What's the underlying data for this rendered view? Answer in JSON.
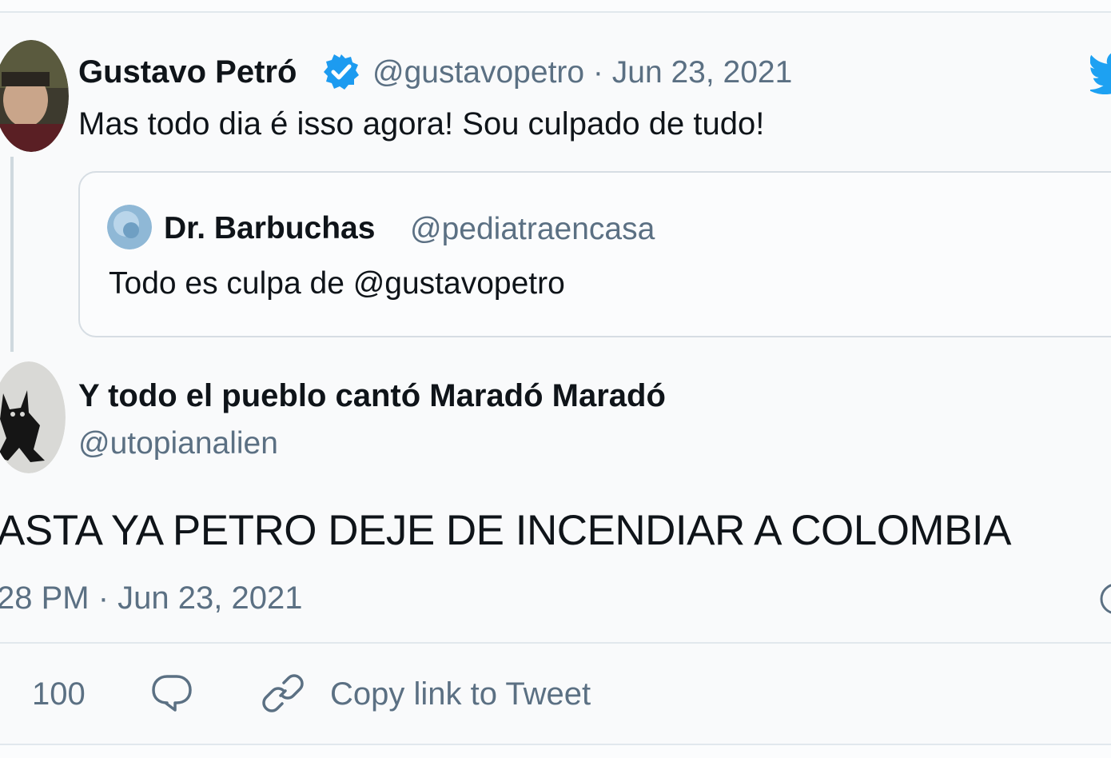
{
  "parent_tweet": {
    "display_name": "Gustavo Petró",
    "handle": "@gustavopetro",
    "separator": "·",
    "date": "Jun 23, 2021",
    "text": "Mas todo dia é isso agora! Sou culpado de tudo!"
  },
  "quoted_tweet": {
    "display_name": "Dr. Barbuchas",
    "handle": "@pediatraencasa",
    "text": "Todo es culpa de @gustavopetro"
  },
  "main_tweet": {
    "display_name": "Y todo el pueblo cantó Maradó Maradó",
    "handle": "@utopianalien",
    "text": "ASTA YA PETRO DEJE DE INCENDIAR A COLOMBIA",
    "timestamp": "28 PM · Jun 23, 2021"
  },
  "actions": {
    "like_count": "100",
    "copy_link_label": "Copy link to Tweet"
  },
  "colors": {
    "verified_blue": "#1d9bf0",
    "twitter_blue": "#1da1f2",
    "secondary_text": "#5b7083",
    "border": "#e1e8ed"
  },
  "icons": [
    "verified-badge-icon",
    "twitter-logo-icon",
    "heart-icon",
    "reply-icon",
    "link-icon",
    "info-icon"
  ]
}
